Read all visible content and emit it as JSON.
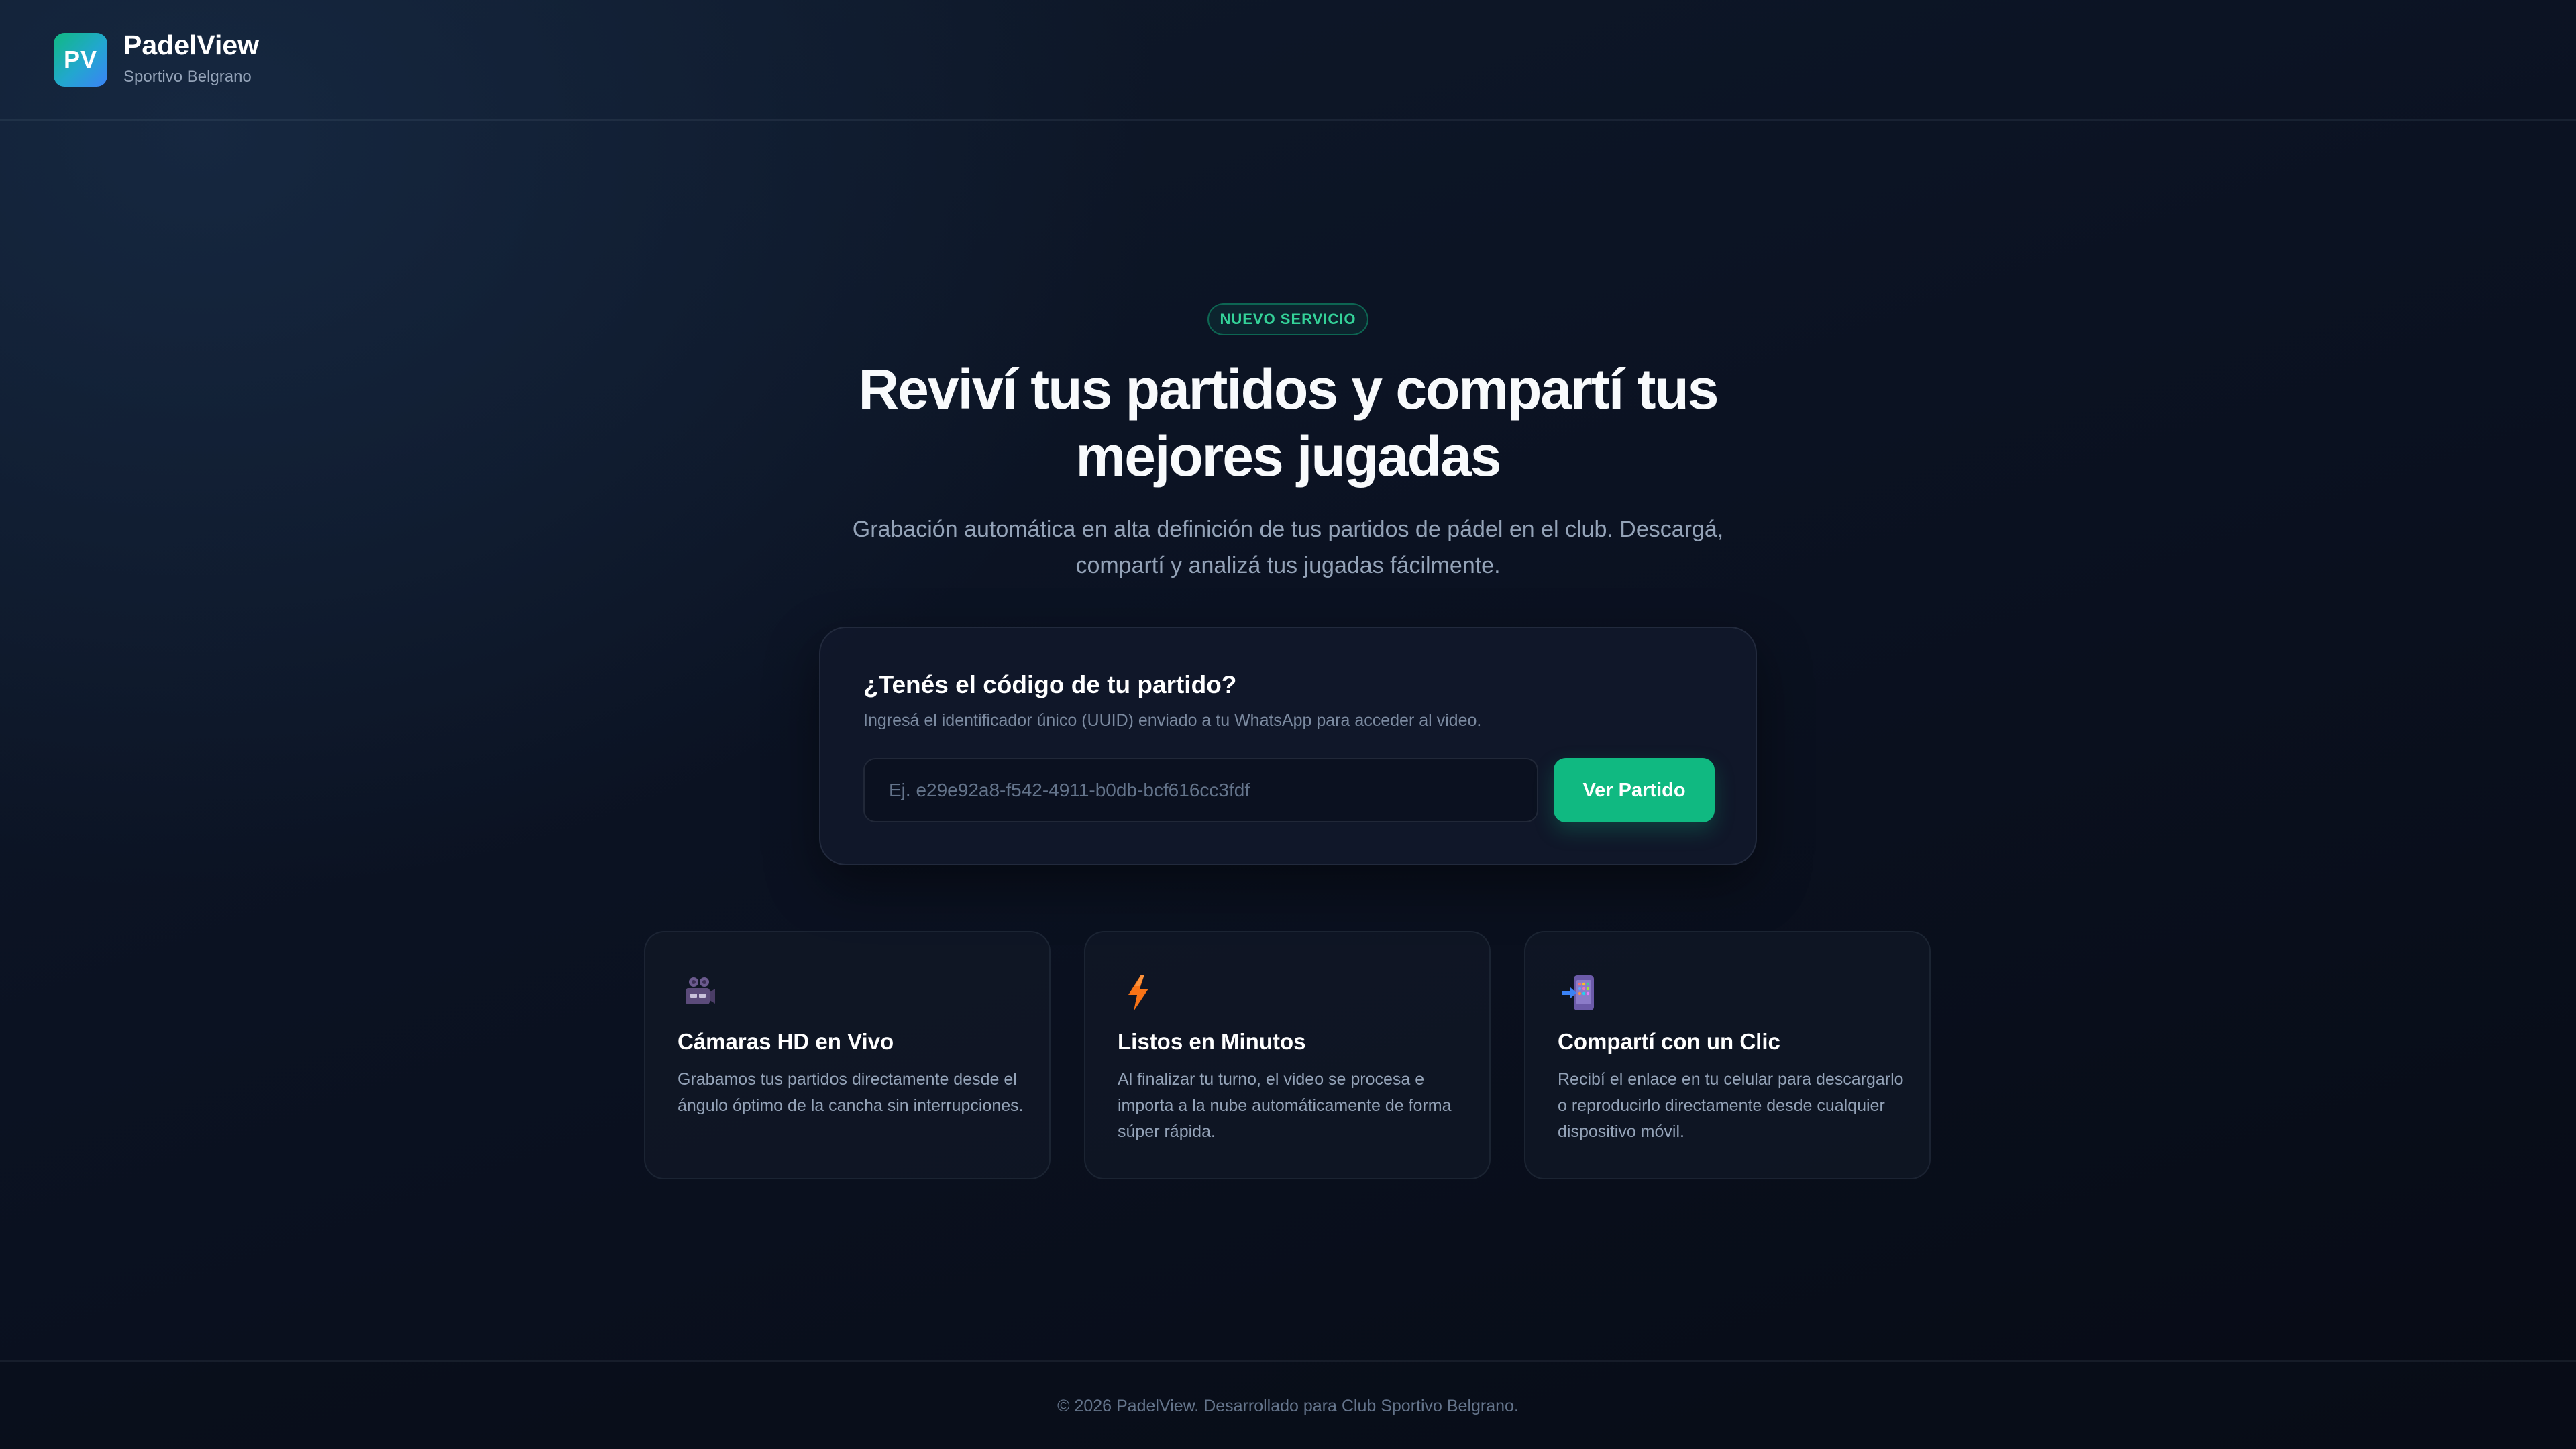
{
  "header": {
    "logo_text": "PV",
    "brand_name": "PadelView",
    "club_name": "Sportivo Belgrano"
  },
  "hero": {
    "badge": "NUEVO SERVICIO",
    "title": "Reviví tus partidos y compartí tus mejores jugadas",
    "subtitle": "Grabación automática en alta definición de tus partidos de pádel en el club. Descargá, compartí y analizá tus jugadas fácilmente."
  },
  "code_card": {
    "title": "¿Tenés el código de tu partido?",
    "help": "Ingresá el identificador único (UUID) enviado a tu WhatsApp para acceder al video.",
    "input_value": "",
    "input_placeholder": "Ej. e29e92a8-f542-4911-b0db-bcf616cc3fdf",
    "button_label": "Ver Partido"
  },
  "features": [
    {
      "icon": "video-camera-icon",
      "title": "Cámaras HD en Vivo",
      "description": "Grabamos tus partidos directamente desde el ángulo óptimo de la cancha sin interrupciones."
    },
    {
      "icon": "lightning-icon",
      "title": "Listos en Minutos",
      "description": "Al finalizar tu turno, el video se procesa e importa a la nube automáticamente de forma súper rápida."
    },
    {
      "icon": "mobile-phone-arrow-icon",
      "title": "Compartí con un Clic",
      "description": "Recibí el enlace en tu celular para descargarlo o reproducirlo directamente desde cualquier dispositivo móvil."
    }
  ],
  "footer": {
    "text": "© 2026 PadelView. Desarrollado para Club Sportivo Belgrano."
  },
  "colors": {
    "accent": "#10b981",
    "background": "#0b1222",
    "card": "#11182a",
    "muted_text": "#94a3b8"
  }
}
